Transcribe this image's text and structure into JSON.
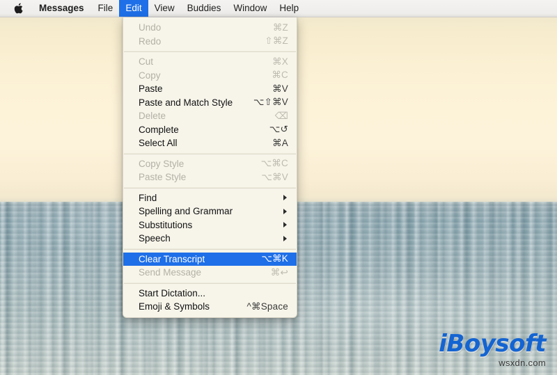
{
  "menubar": {
    "apple_icon": "apple-logo-icon",
    "apple_glyph": "",
    "items": [
      {
        "label": "Messages",
        "active": false,
        "bold": true
      },
      {
        "label": "File",
        "active": false,
        "bold": false
      },
      {
        "label": "Edit",
        "active": true,
        "bold": false
      },
      {
        "label": "View",
        "active": false,
        "bold": false
      },
      {
        "label": "Buddies",
        "active": false,
        "bold": false
      },
      {
        "label": "Window",
        "active": false,
        "bold": false
      },
      {
        "label": "Help",
        "active": false,
        "bold": false
      }
    ]
  },
  "edit_menu": {
    "open": true,
    "highlight_color": "#1e6fe8",
    "background_color": "#f7f5ea",
    "groups": [
      {
        "items": [
          {
            "label": "Undo",
            "shortcut": "⌘Z",
            "enabled": false,
            "submenu": false,
            "highlighted": false
          },
          {
            "label": "Redo",
            "shortcut": "⇧⌘Z",
            "enabled": false,
            "submenu": false,
            "highlighted": false
          }
        ]
      },
      {
        "items": [
          {
            "label": "Cut",
            "shortcut": "⌘X",
            "enabled": false,
            "submenu": false,
            "highlighted": false
          },
          {
            "label": "Copy",
            "shortcut": "⌘C",
            "enabled": false,
            "submenu": false,
            "highlighted": false
          },
          {
            "label": "Paste",
            "shortcut": "⌘V",
            "enabled": true,
            "submenu": false,
            "highlighted": false
          },
          {
            "label": "Paste and Match Style",
            "shortcut": "⌥⇧⌘V",
            "enabled": true,
            "submenu": false,
            "highlighted": false
          },
          {
            "label": "Delete",
            "shortcut": "⌫",
            "enabled": false,
            "submenu": false,
            "highlighted": false
          },
          {
            "label": "Complete",
            "shortcut": "⌥↺",
            "enabled": true,
            "submenu": false,
            "highlighted": false
          },
          {
            "label": "Select All",
            "shortcut": "⌘A",
            "enabled": true,
            "submenu": false,
            "highlighted": false
          }
        ]
      },
      {
        "items": [
          {
            "label": "Copy Style",
            "shortcut": "⌥⌘C",
            "enabled": false,
            "submenu": false,
            "highlighted": false
          },
          {
            "label": "Paste Style",
            "shortcut": "⌥⌘V",
            "enabled": false,
            "submenu": false,
            "highlighted": false
          }
        ]
      },
      {
        "items": [
          {
            "label": "Find",
            "shortcut": "",
            "enabled": true,
            "submenu": true,
            "highlighted": false
          },
          {
            "label": "Spelling and Grammar",
            "shortcut": "",
            "enabled": true,
            "submenu": true,
            "highlighted": false
          },
          {
            "label": "Substitutions",
            "shortcut": "",
            "enabled": true,
            "submenu": true,
            "highlighted": false
          },
          {
            "label": "Speech",
            "shortcut": "",
            "enabled": true,
            "submenu": true,
            "highlighted": false
          }
        ]
      },
      {
        "items": [
          {
            "label": "Clear Transcript",
            "shortcut": "⌥⌘K",
            "enabled": true,
            "submenu": false,
            "highlighted": true
          },
          {
            "label": "Send Message",
            "shortcut": "⌘↩",
            "enabled": false,
            "submenu": false,
            "highlighted": false
          }
        ]
      },
      {
        "items": [
          {
            "label": "Start Dictation...",
            "shortcut": "",
            "enabled": true,
            "submenu": false,
            "highlighted": false
          },
          {
            "label": "Emoji & Symbols",
            "shortcut": "^⌘Space",
            "enabled": true,
            "submenu": false,
            "highlighted": false
          }
        ]
      }
    ]
  },
  "desktop": {
    "wallpaper_description": "ocean-horizon-sunset-wallpaper",
    "sky_color": "#fdf3d9",
    "sea_color": "#9db4b9"
  },
  "watermark": {
    "logo_text": "iBoysoft",
    "logo_color": "#1464d2",
    "subtext": "wsxdn.com"
  }
}
